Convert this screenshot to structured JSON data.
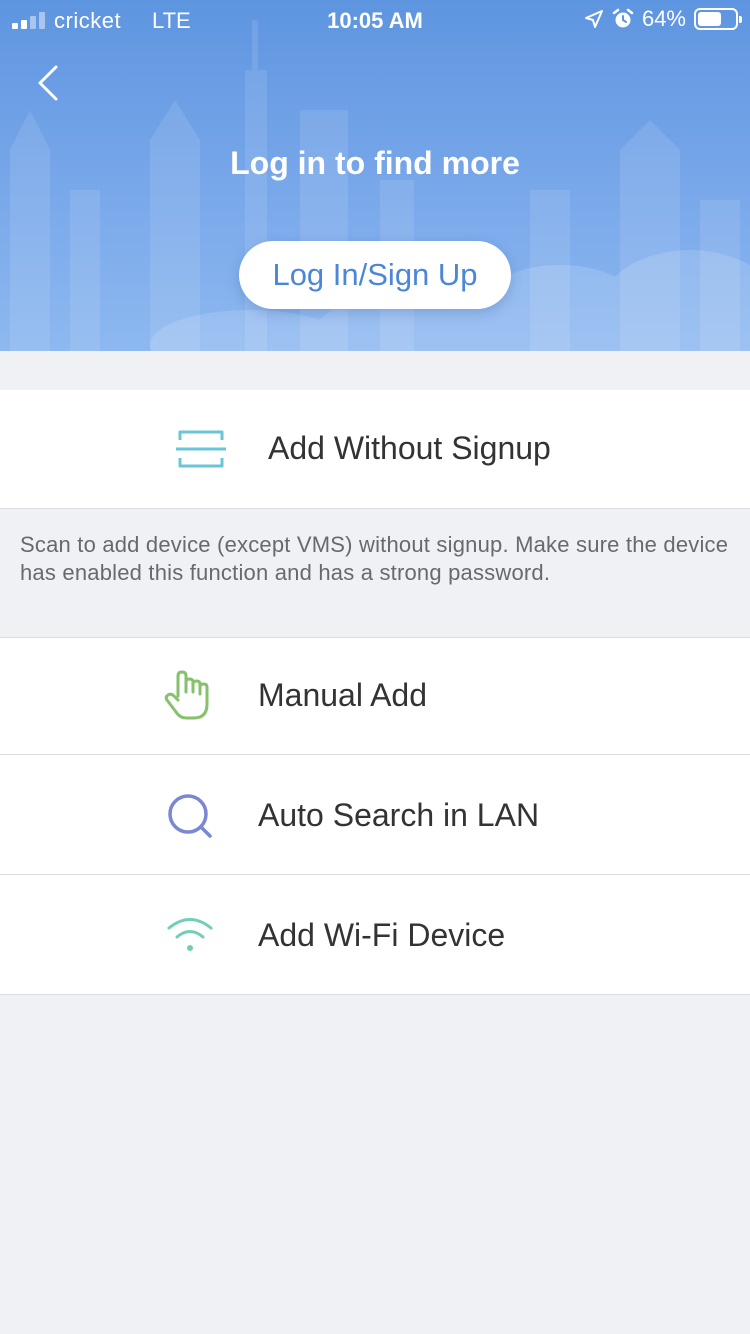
{
  "status_bar": {
    "carrier": "cricket",
    "network": "LTE",
    "time": "10:05 AM",
    "battery": "64%",
    "battery_level": 0.64
  },
  "header": {
    "back_icon": "chevron-left-icon",
    "title": "Log in to find more",
    "login_button": "Log In/Sign Up"
  },
  "options": {
    "add_without_signup": {
      "label": "Add Without Signup",
      "icon": "scan-icon",
      "color": "#6cc4d8"
    },
    "description": "Scan to add device (except VMS) without signup. Make sure the device has enabled this function and has a strong password.",
    "manual_add": {
      "label": "Manual Add",
      "icon": "hand-pointer-icon",
      "color": "#86c16b"
    },
    "auto_search": {
      "label": "Auto Search in LAN",
      "icon": "search-icon",
      "color": "#7b86d4"
    },
    "add_wifi": {
      "label": "Add Wi-Fi Device",
      "icon": "wifi-icon",
      "color": "#6fcfb8"
    }
  },
  "colors": {
    "header_blue": "#5e95e0",
    "accent_blue": "#4c86d8",
    "page_background": "#f0f1f5"
  }
}
